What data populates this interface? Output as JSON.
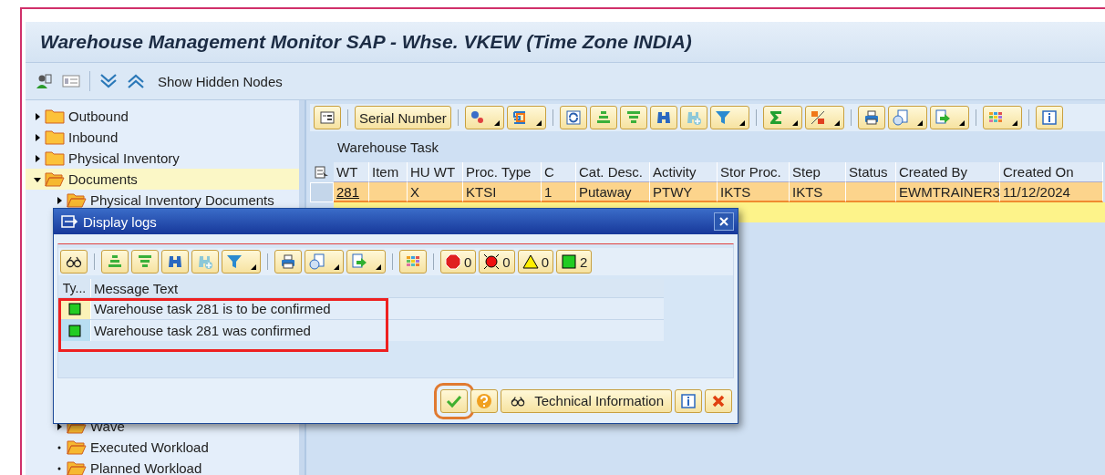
{
  "window": {
    "title": "Warehouse Management Monitor SAP - Whse. VKEW (Time Zone INDIA)"
  },
  "toolbar": {
    "button": "Show Hidden Nodes"
  },
  "tree": [
    {
      "label": "Outbound",
      "kind": "node",
      "expanded": false,
      "selected": false
    },
    {
      "label": "Inbound",
      "kind": "node",
      "expanded": false,
      "selected": false
    },
    {
      "label": "Physical Inventory",
      "kind": "node",
      "expanded": false,
      "selected": false
    },
    {
      "label": "Documents",
      "kind": "node",
      "expanded": true,
      "selected": true,
      "children": [
        {
          "label": "Physical Inventory Documents",
          "kind": "node",
          "expanded": false,
          "selected": false
        },
        {
          "label": "Wave",
          "kind": "node",
          "expanded": false,
          "selected": false
        },
        {
          "label": "Executed Workload",
          "kind": "leaf",
          "selected": false
        },
        {
          "label": "Planned Workload",
          "kind": "leaf",
          "selected": false
        }
      ]
    }
  ],
  "grid": {
    "toolbar_button": "Serial Number",
    "title": "Warehouse Task",
    "columns": [
      "WT",
      "Item",
      "HU WT",
      "Proc. Type",
      "C",
      "Cat. Desc.",
      "Activity",
      "Stor Proc.",
      "Step",
      "Status",
      "Created By",
      "Created On"
    ],
    "rows": [
      {
        "cells": [
          "281",
          "",
          "X",
          "KTSI",
          "1",
          "Putaway",
          "PTWY",
          "IKTS",
          "IKTS",
          "",
          "EWMTRAINER3",
          "11/12/2024"
        ],
        "selected": true
      }
    ]
  },
  "dialog": {
    "title": "Display logs",
    "counters": [
      {
        "kind": "stop",
        "count": "0"
      },
      {
        "kind": "error",
        "count": "0"
      },
      {
        "kind": "warning",
        "count": "0"
      },
      {
        "kind": "success",
        "count": "2"
      }
    ],
    "columns": [
      "Ty...",
      "Message Text"
    ],
    "messages": [
      {
        "color": "#22cc22",
        "text": "Warehouse task 281 is to be confirmed",
        "selected": true
      },
      {
        "color": "#22cc22",
        "text": "Warehouse task 281 was confirmed",
        "selected": false
      }
    ],
    "buttons": [
      {
        "kind": "confirm"
      },
      {
        "kind": "help"
      },
      {
        "kind": "technical",
        "label": "Technical Information"
      },
      {
        "kind": "info"
      },
      {
        "kind": "cancel"
      }
    ]
  }
}
